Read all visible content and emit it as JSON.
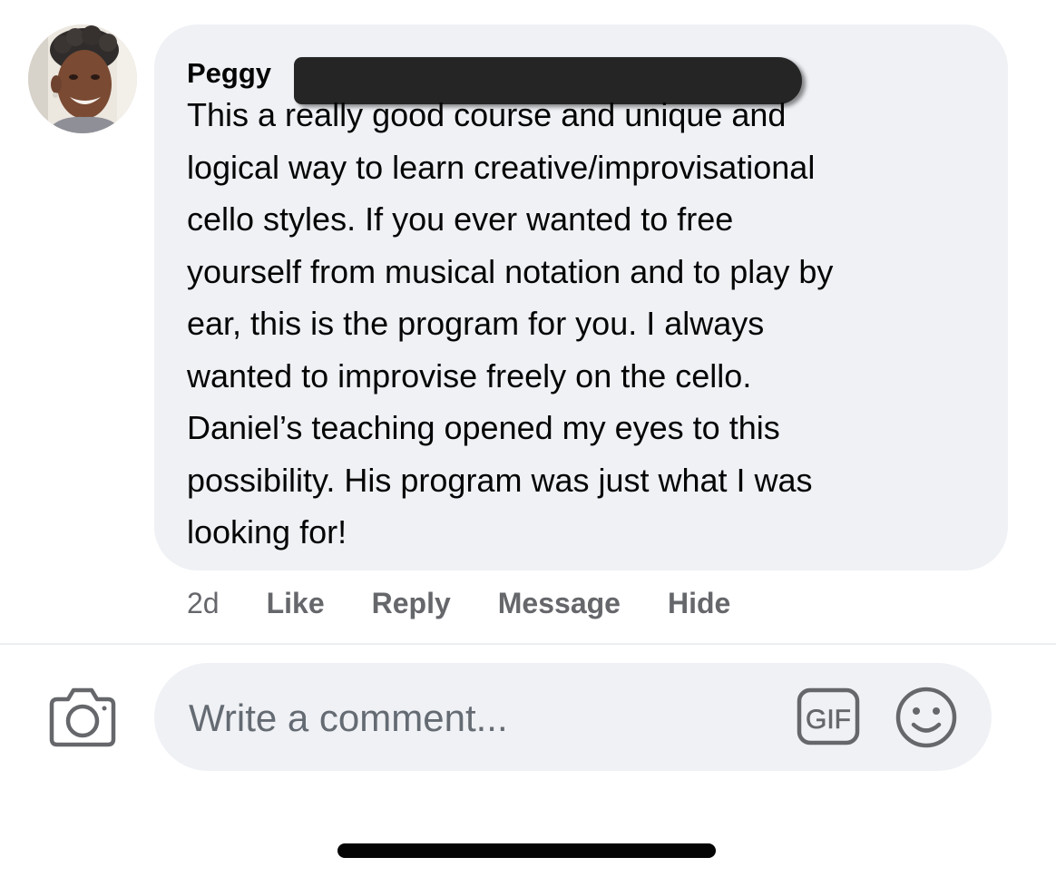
{
  "comment": {
    "author": "Peggy",
    "text": "This a really good course and unique and\nlogical way to learn creative/improvisational\ncello styles. If you ever wanted to free\nyourself from musical notation and to play by\near, this is the program for you. I always\nwanted to improvise freely on the cello.\nDaniel’s teaching opened my eyes to this\npossibility. His program was just what I was\nlooking for!",
    "timestamp": "2d",
    "actions": {
      "like": "Like",
      "reply": "Reply",
      "message": "Message",
      "hide": "Hide"
    }
  },
  "composer": {
    "placeholder": "Write a comment...",
    "gif_label": "GIF"
  },
  "icons": {
    "camera": "camera-icon",
    "gif": "gif-icon",
    "emoji": "smiley-icon"
  },
  "colors": {
    "bubble_background": "#eff1f5",
    "secondary_text": "#65676b",
    "icon_gray": "#65676b",
    "redaction": "#252525"
  }
}
